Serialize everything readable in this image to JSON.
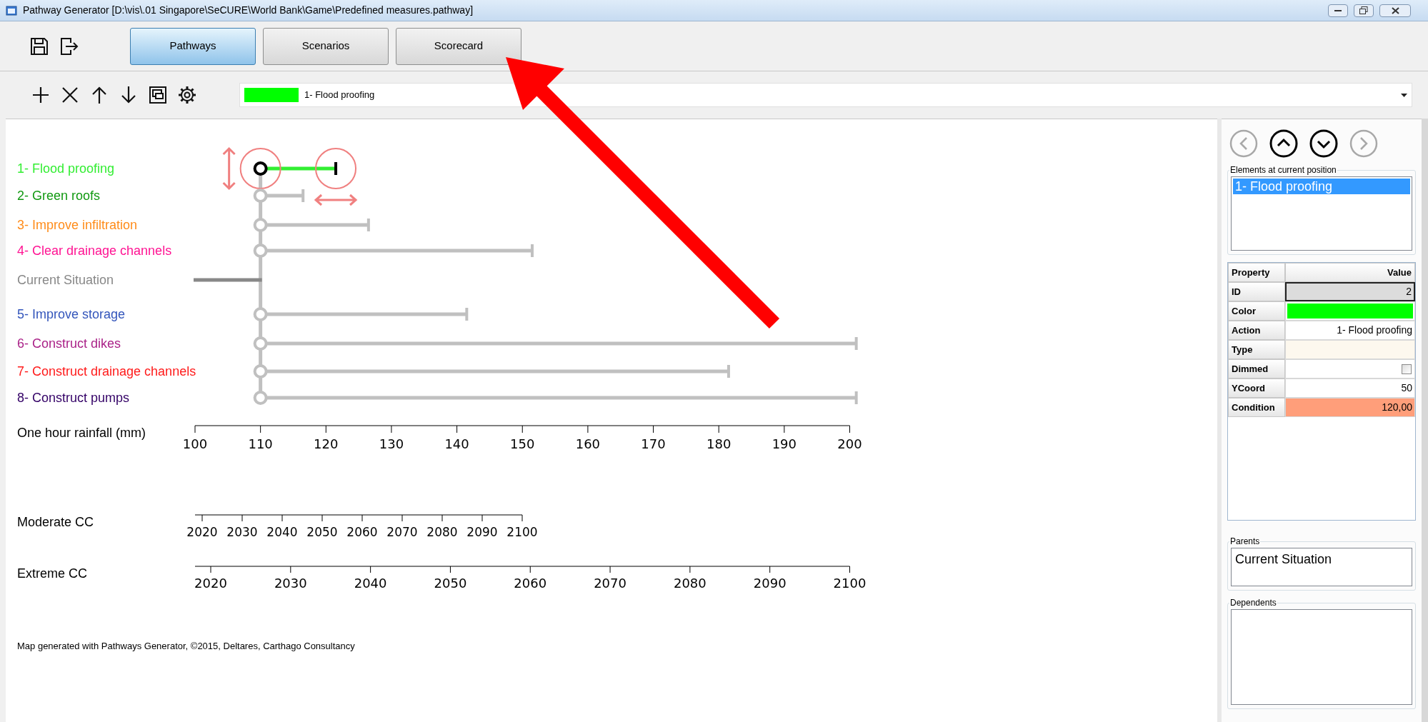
{
  "window": {
    "title": "Pathway Generator [D:\\vis\\.01 Singapore\\SeCURE\\World Bank\\Game\\Predefined measures.pathway]"
  },
  "tabs": [
    {
      "label": "Pathways",
      "selected": true
    },
    {
      "label": "Scenarios",
      "selected": false
    },
    {
      "label": "Scorecard",
      "selected": false
    }
  ],
  "toolbar": [
    {
      "kind": "add"
    },
    {
      "kind": "delete"
    },
    {
      "kind": "up"
    },
    {
      "kind": "down"
    },
    {
      "kind": "copy"
    },
    {
      "kind": "settings"
    }
  ],
  "dropdown": {
    "color": "#00ff00",
    "value": "1- Flood proofing"
  },
  "pathway_map": {
    "rows": [
      {
        "label": "1- Flood proofing",
        "color": "#33ee33",
        "selected": true,
        "kind": "action"
      },
      {
        "label": "2- Green roofs",
        "color": "#119911",
        "selected": false,
        "kind": "action"
      },
      {
        "label": "3- Improve infiltration",
        "color": "#ff8c1a",
        "selected": false,
        "kind": "action"
      },
      {
        "label": "4- Clear drainage channels",
        "color": "#ff1493",
        "selected": false,
        "kind": "action"
      },
      {
        "label": "Current Situation",
        "color": "#888888",
        "selected": false,
        "kind": "current"
      },
      {
        "label": "5- Improve storage",
        "color": "#3355bb",
        "selected": false,
        "kind": "action"
      },
      {
        "label": "6- Construct dikes",
        "color": "#aa2288",
        "selected": false,
        "kind": "action"
      },
      {
        "label": "7- Construct drainage channels",
        "color": "#ff1a1a",
        "selected": false,
        "kind": "action"
      },
      {
        "label": "8- Construct pumps",
        "color": "#330066",
        "selected": false,
        "kind": "action"
      }
    ],
    "axis": {
      "label": "One hour rainfall (mm)",
      "ticks": [
        "100",
        "110",
        "120",
        "130",
        "140",
        "150",
        "160",
        "170",
        "180",
        "190",
        "200"
      ]
    },
    "scales": [
      {
        "label": "Moderate CC",
        "ticks": [
          "2020",
          "2030",
          "2040",
          "2050",
          "2060",
          "2070",
          "2080",
          "2090",
          "2100"
        ]
      },
      {
        "label": "Extreme CC",
        "ticks": [
          "2020",
          "2030",
          "2040",
          "2050",
          "2060",
          "2070",
          "2080",
          "2090",
          "2100"
        ]
      }
    ],
    "footer": "Map generated with Pathways Generator, ©2015, Deltares, Carthago Consultancy"
  },
  "navigation": [
    {
      "kind": "left",
      "disabled": true
    },
    {
      "kind": "up",
      "disabled": false
    },
    {
      "kind": "down",
      "disabled": false
    },
    {
      "kind": "right",
      "disabled": true
    }
  ],
  "elements_panel": {
    "title": "Elements at current position",
    "items": [
      {
        "label": "1- Flood proofing",
        "selected": true
      }
    ]
  },
  "properties": {
    "columns": [
      "Property",
      "Value"
    ],
    "rows": [
      {
        "name": "ID",
        "kind": "id",
        "value": "2",
        "highlighted": false
      },
      {
        "name": "Color",
        "kind": "color",
        "color": "#00ff00",
        "highlighted": false
      },
      {
        "name": "Action",
        "kind": "text",
        "value": "1- Flood proofing",
        "highlighted": false
      },
      {
        "name": "Type",
        "kind": "empty",
        "highlighted": false
      },
      {
        "name": "Dimmed",
        "kind": "checkbox",
        "checked": false,
        "highlighted": false
      },
      {
        "name": "YCoord",
        "kind": "text",
        "value": "50",
        "highlighted": false
      },
      {
        "name": "Condition",
        "kind": "text",
        "value": "120,00",
        "highlighted": true
      }
    ]
  },
  "parents": {
    "title": "Parents",
    "items": [
      "Current Situation"
    ]
  },
  "dependents": {
    "title": "Dependents"
  }
}
